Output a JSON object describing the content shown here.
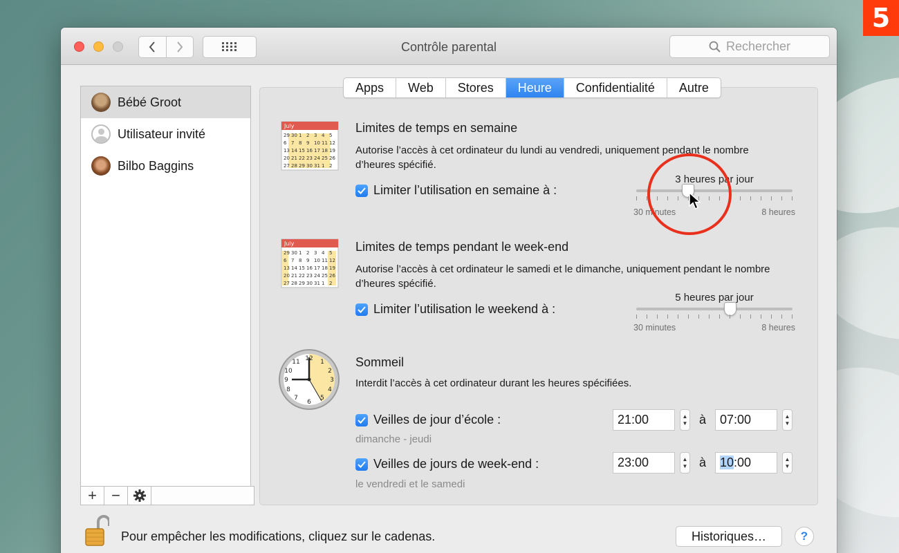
{
  "badge": "5",
  "window": {
    "title": "Contrôle parental"
  },
  "search": {
    "placeholder": "Rechercher"
  },
  "users": [
    {
      "name": "Bébé Groot",
      "selected": true
    },
    {
      "name": "Utilisateur invité",
      "selected": false
    },
    {
      "name": "Bilbo Baggins",
      "selected": false
    }
  ],
  "users_toolbar": {
    "add": "+",
    "remove": "−"
  },
  "tabs": [
    {
      "label": "Apps"
    },
    {
      "label": "Web"
    },
    {
      "label": "Stores"
    },
    {
      "label": "Heure",
      "active": true
    },
    {
      "label": "Confidentialité"
    },
    {
      "label": "Autre"
    }
  ],
  "weekday": {
    "calendar_month": "July",
    "title": "Limites de temps en semaine",
    "desc": "Autorise l’accès à cet ordinateur du lundi au vendredi, uniquement pendant le nombre d’heures spécifié.",
    "checkbox_label": "Limiter l’utilisation en semaine à :",
    "checked": true,
    "slider_value": "3 heures par jour",
    "slider_fraction": 0.33,
    "min_label": "30 minutes",
    "max_label": "8 heures"
  },
  "weekend": {
    "calendar_month": "July",
    "title": "Limites de temps pendant le week-end",
    "desc": "Autorise l’accès à cet ordinateur le samedi et le dimanche, uniquement pendant le nombre d’heures spécifié.",
    "checkbox_label": "Limiter l’utilisation le weekend à :",
    "checked": true,
    "slider_value": "5 heures par jour",
    "slider_fraction": 0.6,
    "min_label": "30 minutes",
    "max_label": "8 heures"
  },
  "sleep": {
    "title": "Sommeil",
    "desc": "Interdit l’accès à cet ordinateur durant les heures spécifiées.",
    "school": {
      "label": "Veilles de jour d’école :",
      "sub": "dimanche - jeudi",
      "from": "21:00",
      "sep": "à",
      "to": "07:00",
      "checked": true
    },
    "weekend": {
      "label": "Veilles de jours de week-end :",
      "sub": "le vendredi et le samedi",
      "from": "23:00",
      "sep": "à",
      "to_highlight": "10",
      "to_rest": ":00",
      "checked": true
    }
  },
  "footer": {
    "lock_text": "Pour empêcher les modifications, cliquez sur le cadenas.",
    "history_button": "Historiques…",
    "help": "?"
  },
  "colors": {
    "accent": "#2f84f1",
    "annotation": "#e8301c",
    "badge": "#ff3b0b"
  }
}
